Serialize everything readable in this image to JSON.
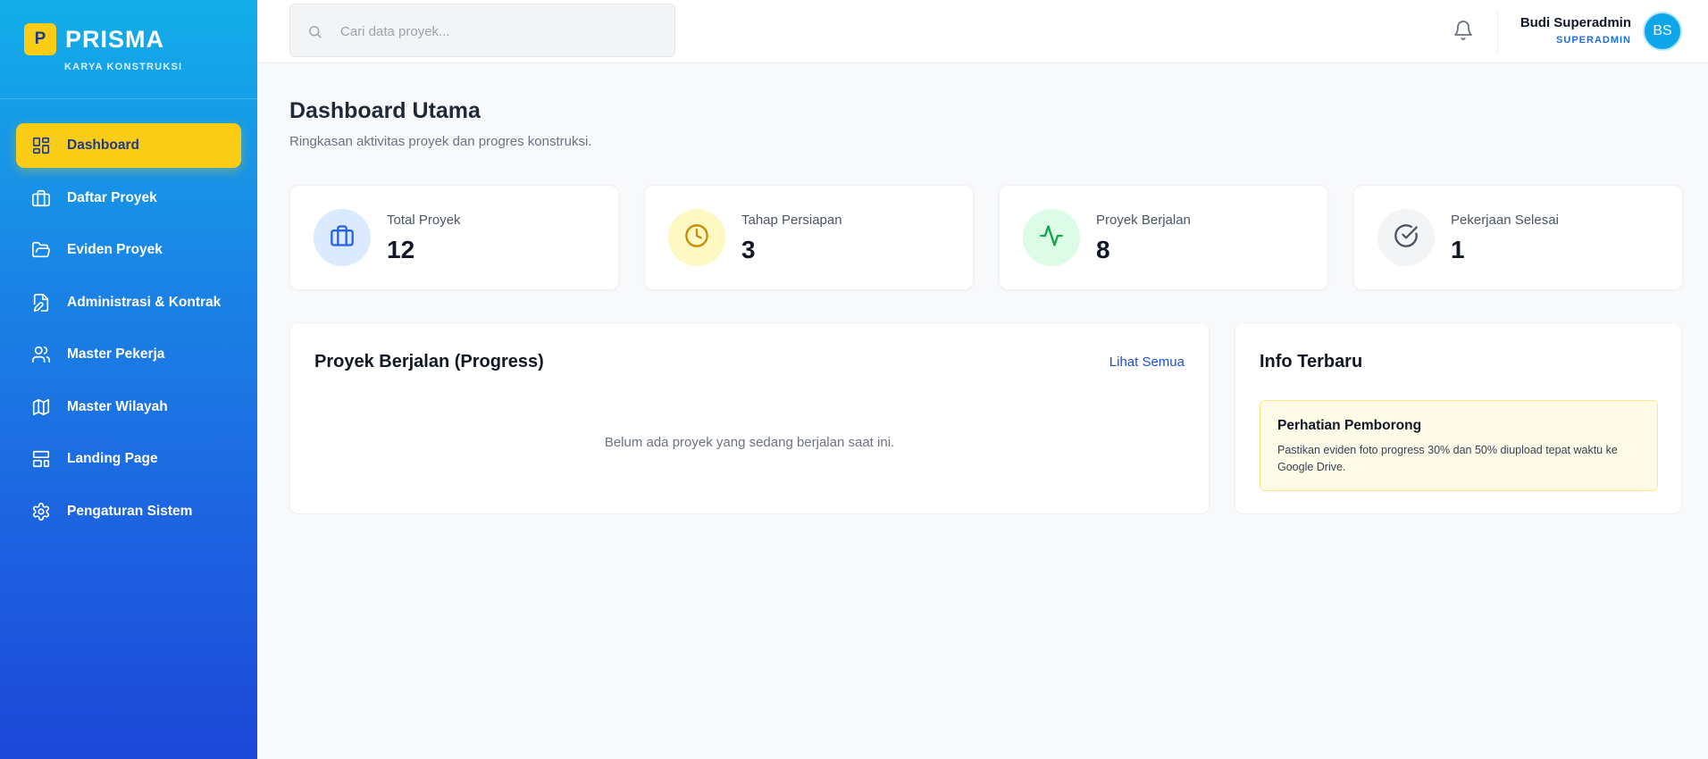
{
  "brand": {
    "logo_letter": "P",
    "name": "PRISMA",
    "subtitle": "KARYA KONSTRUKSI"
  },
  "sidebar": {
    "items": [
      {
        "label": "Dashboard",
        "icon": "grid-icon",
        "active": true
      },
      {
        "label": "Daftar Proyek",
        "icon": "briefcase-icon"
      },
      {
        "label": "Eviden Proyek",
        "icon": "folder-open-icon"
      },
      {
        "label": "Administrasi & Kontrak",
        "icon": "file-edit-icon"
      },
      {
        "label": "Master Pekerja",
        "icon": "users-icon"
      },
      {
        "label": "Master Wilayah",
        "icon": "map-icon"
      },
      {
        "label": "Landing Page",
        "icon": "layout-icon"
      },
      {
        "label": "Pengaturan Sistem",
        "icon": "gear-icon"
      }
    ]
  },
  "topbar": {
    "search_placeholder": "Cari data proyek...",
    "user_name": "Budi Superadmin",
    "user_role": "SUPERADMIN",
    "avatar_initials": "BS"
  },
  "page": {
    "title": "Dashboard Utama",
    "subtitle": "Ringkasan aktivitas proyek dan progres konstruksi."
  },
  "stats": [
    {
      "label": "Total Proyek",
      "value": "12",
      "icon": "briefcase-icon",
      "bg": "#dbeafe",
      "color": "#2563eb"
    },
    {
      "label": "Tahap Persiapan",
      "value": "3",
      "icon": "clock-icon",
      "bg": "#fef9c3",
      "color": "#ca8a04"
    },
    {
      "label": "Proyek Berjalan",
      "value": "8",
      "icon": "activity-icon",
      "bg": "#dcfce7",
      "color": "#16a34a"
    },
    {
      "label": "Pekerjaan Selesai",
      "value": "1",
      "icon": "check-circle-icon",
      "bg": "#f3f4f6",
      "color": "#4b5563"
    }
  ],
  "progress_panel": {
    "title": "Proyek Berjalan (Progress)",
    "link": "Lihat Semua",
    "empty": "Belum ada proyek yang sedang berjalan saat ini."
  },
  "info_panel": {
    "title": "Info Terbaru",
    "notice_title": "Perhatian Pemborong",
    "notice_body": "Pastikan eviden foto progress 30% dan 50% diupload tepat waktu ke Google Drive."
  }
}
